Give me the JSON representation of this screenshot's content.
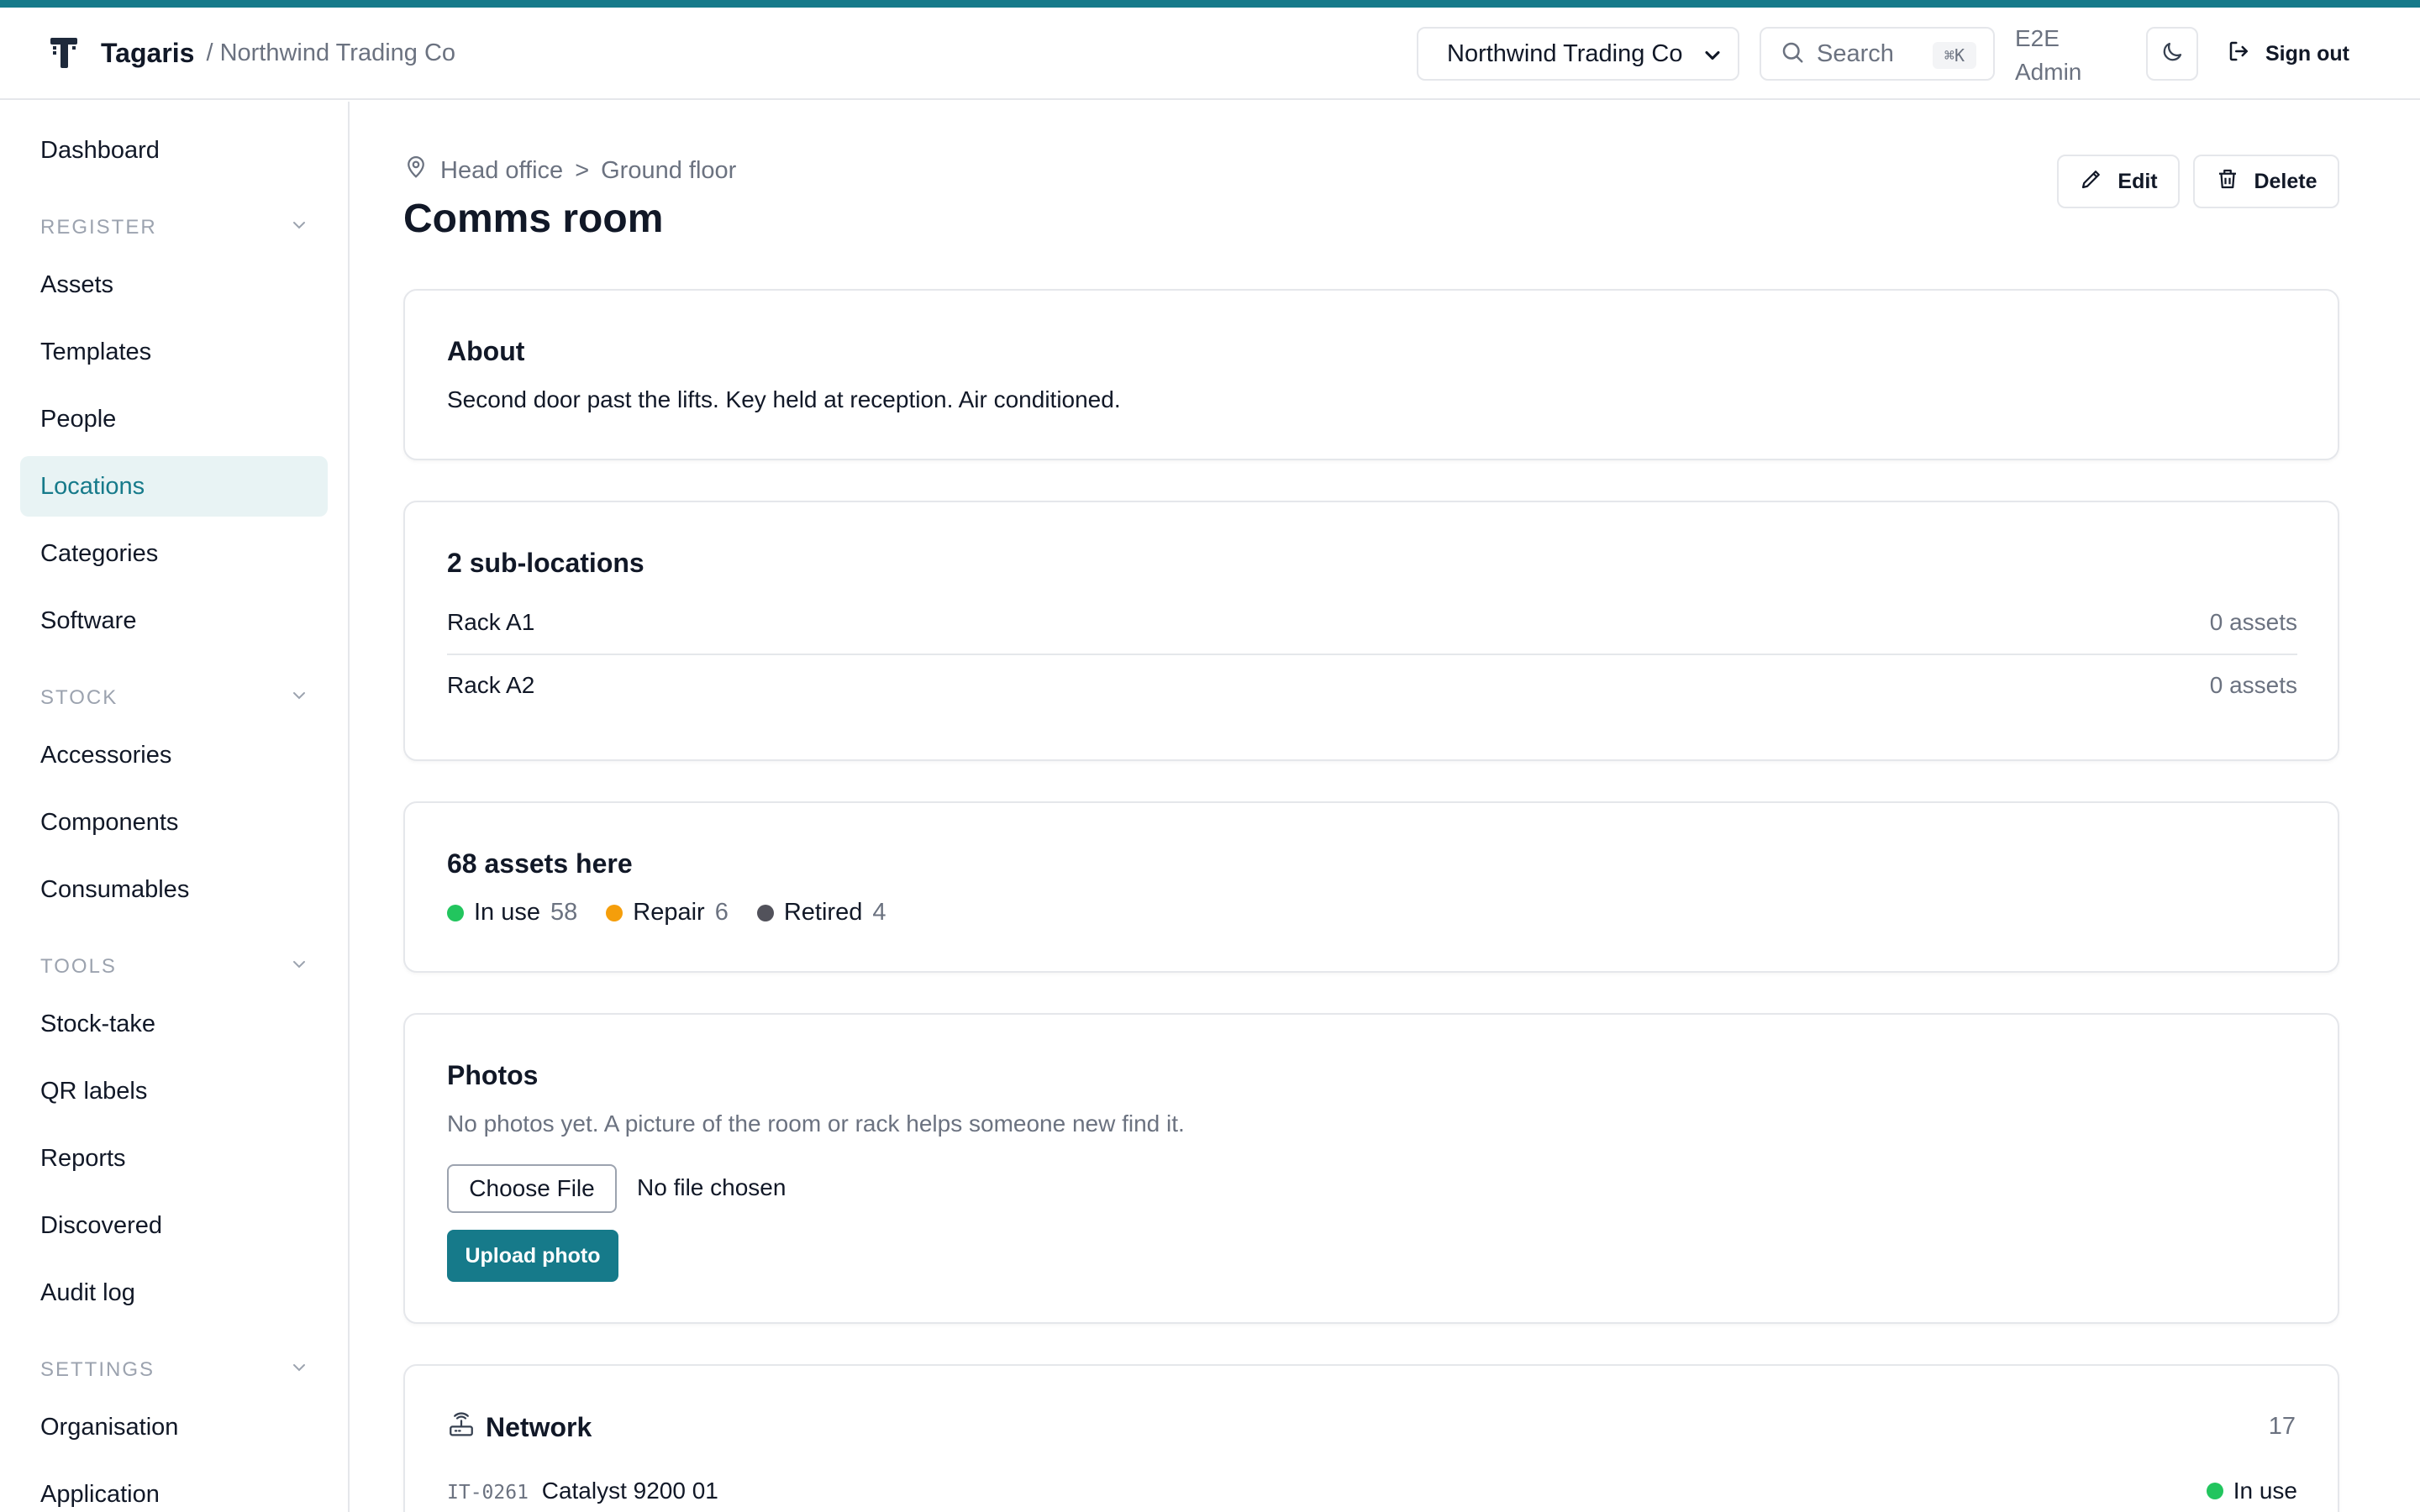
{
  "colors": {
    "accent": "#167a8a",
    "in_use": "#22c55e",
    "repair": "#f59e0b",
    "retired": "#52525b"
  },
  "header": {
    "brand": "Tagaris",
    "org_crumb": "/ Northwind Trading Co",
    "org_select": "Northwind Trading Co",
    "search_label": "Search",
    "search_shortcut": "⌘K",
    "user_line1": "E2E",
    "user_line2": "Admin",
    "signout": "Sign out"
  },
  "sidebar": {
    "dashboard": "Dashboard",
    "groups": {
      "register": "REGISTER",
      "stock": "STOCK",
      "tools": "TOOLS",
      "settings": "SETTINGS"
    },
    "items": {
      "assets": "Assets",
      "templates": "Templates",
      "people": "People",
      "locations": "Locations",
      "categories": "Categories",
      "software": "Software",
      "accessories": "Accessories",
      "components": "Components",
      "consumables": "Consumables",
      "stocktake": "Stock-take",
      "qr_labels": "QR labels",
      "reports": "Reports",
      "discovered": "Discovered",
      "audit_log": "Audit log",
      "organisation": "Organisation",
      "application": "Application"
    },
    "active": "Locations"
  },
  "page": {
    "breadcrumb": [
      "Head office",
      "Ground floor"
    ],
    "breadcrumb_sep": ">",
    "title": "Comms room",
    "edit": "Edit",
    "delete": "Delete"
  },
  "about": {
    "title": "About",
    "text": "Second door past the lifts. Key held at reception. Air conditioned."
  },
  "sublocations": {
    "title": "2 sub-locations",
    "rows": [
      {
        "name": "Rack A1",
        "count": "0 assets"
      },
      {
        "name": "Rack A2",
        "count": "0 assets"
      }
    ]
  },
  "assets_summary": {
    "title": "68 assets here",
    "statuses": [
      {
        "label": "In use",
        "count": "58"
      },
      {
        "label": "Repair",
        "count": "6"
      },
      {
        "label": "Retired",
        "count": "4"
      }
    ]
  },
  "photos": {
    "title": "Photos",
    "empty_text": "No photos yet. A picture of the room or rack helps someone new find it.",
    "choose_file": "Choose File",
    "no_file": "No file chosen",
    "upload": "Upload photo"
  },
  "network": {
    "title": "Network",
    "count": "17",
    "rows": [
      {
        "tag": "IT-0261",
        "name": "Catalyst 9200 01",
        "status": "In use"
      }
    ]
  }
}
